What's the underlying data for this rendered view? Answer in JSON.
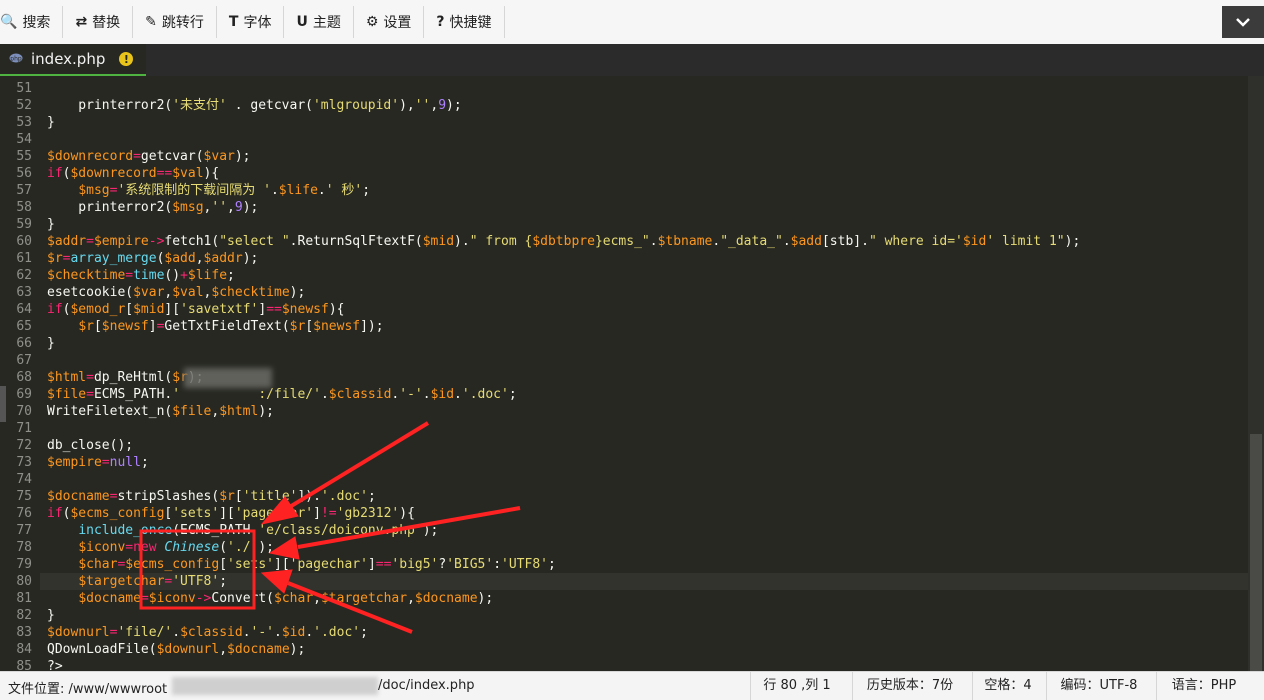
{
  "toolbar": {
    "items": [
      {
        "icon": "search-icon",
        "glyph": "🔍",
        "label": "搜索"
      },
      {
        "icon": "replace-icon",
        "glyph": "⇄",
        "label": "替换"
      },
      {
        "icon": "goto-line-icon",
        "glyph": "✎",
        "label": "跳转行"
      },
      {
        "icon": "font-icon",
        "glyph": "T",
        "label": "字体"
      },
      {
        "icon": "theme-icon",
        "glyph": "U",
        "label": "主题"
      },
      {
        "icon": "gear-icon",
        "glyph": "⚙",
        "label": "设置"
      },
      {
        "icon": "keyboard-icon",
        "glyph": "?",
        "label": "快捷键"
      }
    ],
    "collapse_glyph": "⌄"
  },
  "tab": {
    "filename": "index.php",
    "warn_glyph": "!"
  },
  "editor": {
    "active_line": 80,
    "lines": [
      {
        "n": "51",
        "html": ""
      },
      {
        "n": "52",
        "html": "    printerror2(<span class='str'>'未支付'</span> . getcvar(<span class='str'>'mlgroupid'</span>),<span class='str'>''</span>,<span class='num'>9</span>);"
      },
      {
        "n": "53",
        "html": "}"
      },
      {
        "n": "54",
        "html": ""
      },
      {
        "n": "55",
        "html": "<span class='var'>$downrecord</span><span class='kw'>=</span>getcvar(<span class='var'>$var</span>);"
      },
      {
        "n": "56",
        "html": "<span class='kw'>if</span>(<span class='var'>$downrecord</span><span class='kw'>==</span><span class='var'>$val</span>){"
      },
      {
        "n": "57",
        "html": "    <span class='var'>$msg</span><span class='kw'>=</span><span class='str'>'系统限制的下载间隔为 '</span>.<span class='var'>$life</span>.<span class='str'>' 秒'</span>;"
      },
      {
        "n": "58",
        "html": "    printerror2(<span class='var'>$msg</span>,<span class='str'>''</span>,<span class='num'>9</span>);"
      },
      {
        "n": "59",
        "html": "}"
      },
      {
        "n": "60",
        "html": "<span class='var'>$addr</span><span class='kw'>=</span><span class='var'>$empire</span><span class='kw'>-&gt;</span>fetch1(<span class='str'>\"select \"</span>.ReturnSqlFtextF(<span class='var'>$mid</span>).<span class='str'>\" from {</span><span class='var'>$dbtbpre</span><span class='str'>}ecms_\"</span>.<span class='var'>$tbname</span>.<span class='str'>\"_data_\"</span>.<span class='var'>$add</span>[stb].<span class='str'>\" where id='</span><span class='var'>$id</span><span class='str'>' limit 1\"</span>);"
      },
      {
        "n": "61",
        "html": "<span class='var'>$r</span><span class='kw'>=</span><span class='fn'>array_merge</span>(<span class='var'>$add</span>,<span class='var'>$addr</span>);"
      },
      {
        "n": "62",
        "html": "<span class='var'>$checktime</span><span class='kw'>=</span><span class='fn'>time</span>()<span class='kw'>+</span><span class='var'>$life</span>;"
      },
      {
        "n": "63",
        "html": "esetcookie(<span class='var'>$var</span>,<span class='var'>$val</span>,<span class='var'>$checktime</span>);"
      },
      {
        "n": "64",
        "html": "<span class='kw'>if</span>(<span class='var'>$emod_r</span>[<span class='var'>$mid</span>][<span class='str'>'savetxtf'</span>]<span class='kw'>==</span><span class='var'>$newsf</span>){"
      },
      {
        "n": "65",
        "html": "    <span class='var'>$r</span>[<span class='var'>$newsf</span>]<span class='kw'>=</span>GetTxtFieldText(<span class='var'>$r</span>[<span class='var'>$newsf</span>]);"
      },
      {
        "n": "66",
        "html": "}"
      },
      {
        "n": "67",
        "html": ""
      },
      {
        "n": "68",
        "html": "<span class='var'>$html</span><span class='kw'>=</span>dp_ReHtml(<span class='var'>$r</span>);"
      },
      {
        "n": "69",
        "html": "<span class='var'>$file</span><span class='kw'>=</span>ECMS_PATH.<span class='str'>'          :/file/'</span>.<span class='var'>$classid</span>.<span class='str'>'-'</span>.<span class='var'>$id</span>.<span class='str'>'.doc'</span>;"
      },
      {
        "n": "70",
        "html": "WriteFiletext_n(<span class='var'>$file</span>,<span class='var'>$html</span>);"
      },
      {
        "n": "71",
        "html": ""
      },
      {
        "n": "72",
        "html": "db_close();"
      },
      {
        "n": "73",
        "html": "<span class='var'>$empire</span><span class='kw'>=</span><span class='num'>null</span>;"
      },
      {
        "n": "74",
        "html": ""
      },
      {
        "n": "75",
        "html": "<span class='var'>$docname</span><span class='kw'>=</span>stripSlashes(<span class='var'>$r</span>[<span class='str'>'title'</span>]).<span class='str'>'.doc'</span>;"
      },
      {
        "n": "76",
        "html": "<span class='kw'>if</span>(<span class='var'>$ecms_config</span>[<span class='str'>'sets'</span>][<span class='str'>'pagechar'</span>]<span class='kw'>!=</span><span class='str'>'gb2312'</span>){"
      },
      {
        "n": "77",
        "html": "    <span class='fn'>include_once</span>(ECMS_PATH.<span class='str'>'e/class/doiconv.php'</span>);"
      },
      {
        "n": "78",
        "html": "    <span class='var'>$iconv</span><span class='kw'>=new</span> <span class='cls'>Chinese</span>(<span class='str'>'./'</span>);"
      },
      {
        "n": "79",
        "html": "    <span class='var'>$char</span><span class='kw'>=</span><span class='var'>$ecms_config</span>[<span class='str'>'sets'</span>][<span class='str'>'pagechar'</span>]<span class='kw'>==</span><span class='str'>'big5'</span>?<span class='str'>'BIG5'</span>:<span class='str'>'UTF8'</span>;"
      },
      {
        "n": "80",
        "html": "    <span class='var'>$targetchar</span><span class='kw'>=</span><span class='str'>'UTF8'</span>;"
      },
      {
        "n": "81",
        "html": "    <span class='var'>$docname</span><span class='kw'>=</span><span class='var'>$iconv</span><span class='kw'>-&gt;</span>Convert(<span class='var'>$char</span>,<span class='var'>$targetchar</span>,<span class='var'>$docname</span>);"
      },
      {
        "n": "82",
        "html": "}"
      },
      {
        "n": "83",
        "html": "<span class='var'>$downurl</span><span class='kw'>=</span><span class='str'>'file/'</span>.<span class='var'>$classid</span>.<span class='str'>'-'</span>.<span class='var'>$id</span>.<span class='str'>'.doc'</span>;"
      },
      {
        "n": "84",
        "html": "QDownLoadFile(<span class='var'>$downurl</span>,<span class='var'>$docname</span>);"
      },
      {
        "n": "85",
        "html": "?&gt;"
      }
    ]
  },
  "status": {
    "path_label": "文件位置:",
    "path_head": "/www/wwwroot",
    "path_tail": "/doc/index.php",
    "cursor": "行 80 ,列 1",
    "history": "历史版本：7份",
    "spaces": "空格：4",
    "encoding": "编码：UTF-8",
    "language": "语言：PHP"
  },
  "colors": {
    "editor_bg": "#272822",
    "annotation_red": "#ff2222",
    "tab_accent": "#4fb341"
  }
}
